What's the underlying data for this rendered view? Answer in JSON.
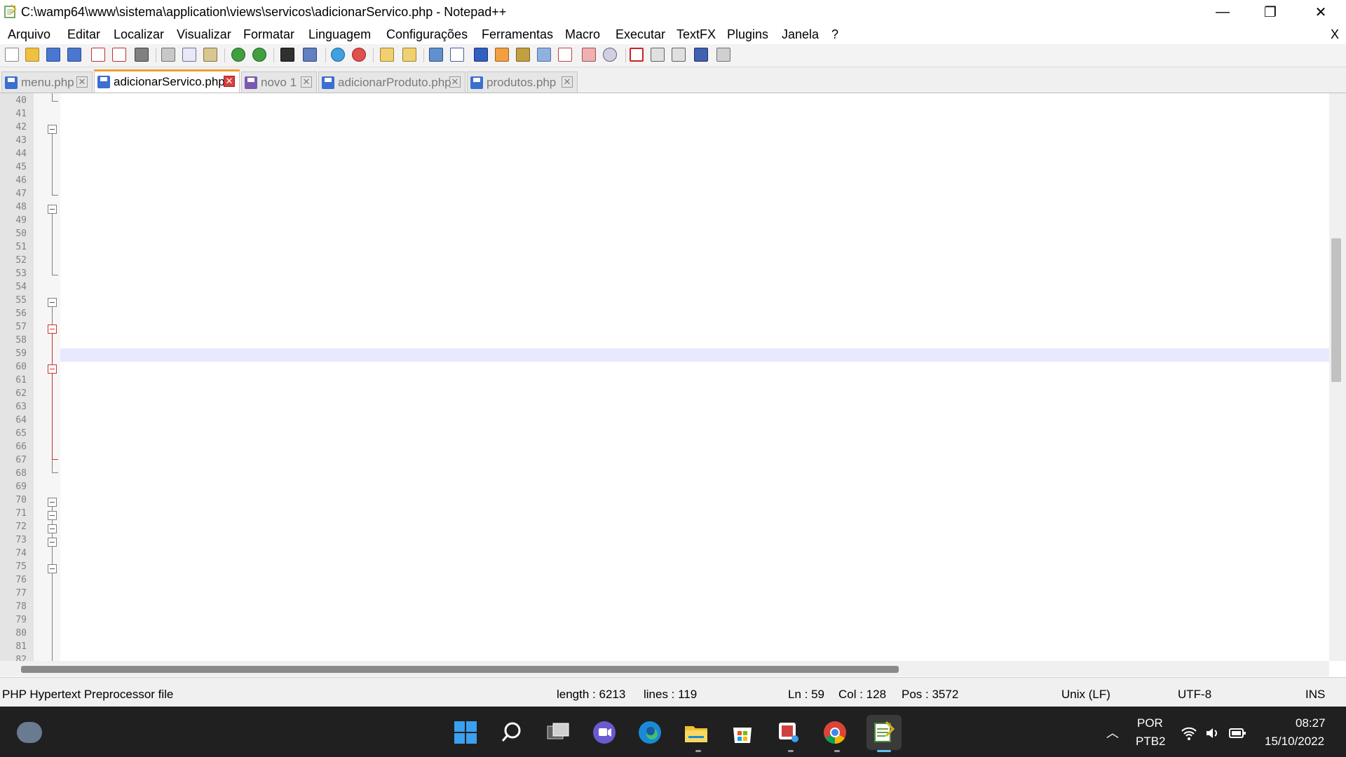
{
  "window": {
    "title": "C:\\wamp64\\www\\sistema\\application\\views\\servicos\\adicionarServico.php - Notepad++",
    "minimize": "—",
    "maximize": "❐",
    "close": "✕"
  },
  "menu": {
    "items": [
      "Arquivo",
      "Editar",
      "Localizar",
      "Visualizar",
      "Formatar",
      "Linguagem",
      "Configurações",
      "Ferramentas",
      "Macro",
      "Executar",
      "TextFX",
      "Plugins",
      "Janela",
      "?"
    ],
    "close_doc": "X"
  },
  "tabs": [
    {
      "label": "menu.php",
      "active": false
    },
    {
      "label": "adicionarServico.php",
      "active": true
    },
    {
      "label": "novo 1",
      "active": false
    },
    {
      "label": "adicionarProduto.php",
      "active": false
    },
    {
      "label": "produtos.php",
      "active": false
    }
  ],
  "editor": {
    "line_numbers": [
      "40",
      "41",
      "42",
      "43",
      "44",
      "45",
      "46",
      "47",
      "48",
      "49",
      "50",
      "51",
      "52",
      "53",
      "54",
      "55",
      "56",
      "57",
      "58",
      "59",
      "60",
      "61",
      "62",
      "63",
      "64",
      "65",
      "66",
      "67",
      "68",
      "69",
      "70",
      "71",
      "72",
      "73",
      "74",
      "75",
      "76",
      "77",
      "78",
      "79",
      "80",
      "81",
      "82"
    ],
    "current_line": "59"
  },
  "status": {
    "file_type": "PHP Hypertext Preprocessor file",
    "length": "length : 6213",
    "lines": "lines : 119",
    "ln": "Ln : 59",
    "col": "Col : 128",
    "pos": "Pos : 3572",
    "eol": "Unix (LF)",
    "encoding": "UTF-8",
    "mode": "INS"
  },
  "taskbar": {
    "lang_top": "POR",
    "lang_bottom": "PTB2",
    "time": "08:27",
    "date": "15/10/2022"
  },
  "colors": {
    "comment": "#008000",
    "tag": "#0000ff",
    "attribute": "#ff0000",
    "value": "#8000ff",
    "taskbar": "#202020",
    "active_tab_accent": "#f0a030"
  }
}
